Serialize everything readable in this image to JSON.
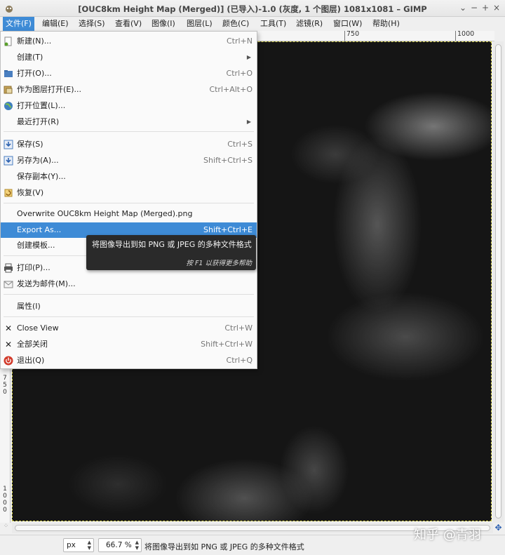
{
  "window": {
    "title": "[OUC8km Height Map (Merged)] (已导入)-1.0 (灰度, 1 个图层) 1081x1081 – GIMP",
    "controls": [
      "⌄",
      "−",
      "+",
      "×"
    ]
  },
  "menubar": [
    "文件(F)",
    "编辑(E)",
    "选择(S)",
    "查看(V)",
    "图像(I)",
    "图层(L)",
    "颜色(C)",
    "工具(T)",
    "滤镜(R)",
    "窗口(W)",
    "帮助(H)"
  ],
  "rulers": {
    "top": [
      "750",
      "1000"
    ],
    "left": [
      [
        "7",
        "5",
        "0"
      ],
      [
        "1",
        "0",
        "0",
        "0"
      ]
    ]
  },
  "file_menu": {
    "items": [
      {
        "label": "新建(N)...",
        "accel": "Ctrl+N",
        "icon": "new-document-icon"
      },
      {
        "label": "创建(T)",
        "accel": "",
        "submenu": true
      },
      {
        "label": "打开(O)...",
        "accel": "Ctrl+O",
        "icon": "open-folder-icon"
      },
      {
        "label": "作为图层打开(E)...",
        "accel": "Ctrl+Alt+O",
        "icon": "open-as-layers-icon"
      },
      {
        "label": "打开位置(L)...",
        "accel": "",
        "icon": "globe-icon"
      },
      {
        "label": "最近打开(R)",
        "accel": "",
        "submenu": true
      },
      {
        "label": "保存(S)",
        "accel": "Ctrl+S",
        "icon": "save-icon"
      },
      {
        "label": "另存为(A)...",
        "accel": "Shift+Ctrl+S",
        "icon": "save-as-icon"
      },
      {
        "label": "保存副本(Y)...",
        "accel": ""
      },
      {
        "label": "恢复(V)",
        "accel": "",
        "icon": "revert-icon"
      },
      {
        "label": "Overwrite OUC8km Height Map (Merged).png",
        "accel": ""
      },
      {
        "label": "Export As...",
        "accel": "Shift+Ctrl+E",
        "highlighted": true
      },
      {
        "label": "创建模板...",
        "accel": ""
      },
      {
        "label": "打印(P)...",
        "accel": "",
        "icon": "printer-icon"
      },
      {
        "label": "发送为邮件(M)...",
        "accel": "",
        "icon": "mail-icon"
      },
      {
        "label": "属性(I)",
        "accel": ""
      },
      {
        "label": "Close View",
        "accel": "Ctrl+W",
        "icon": "close-icon"
      },
      {
        "label": "全部关闭",
        "accel": "Shift+Ctrl+W",
        "icon": "close-icon"
      },
      {
        "label": "退出(Q)",
        "accel": "Ctrl+Q",
        "icon": "quit-icon"
      }
    ]
  },
  "tooltip": {
    "text": "将图像导出到如 PNG 或 JPEG 的多种文件格式",
    "hint": "按 F1 以获得更多帮助"
  },
  "statusbar": {
    "unit": "px",
    "zoom": "66.7 %",
    "message": "将图像导出到如 PNG 或 JPEG 的多种文件格式"
  },
  "watermark": "知乎 @青羽",
  "colors": {
    "accent": "#3e8bd6",
    "menu_bg": "#fafafa",
    "tooltip_bg": "#2a2a2a"
  }
}
